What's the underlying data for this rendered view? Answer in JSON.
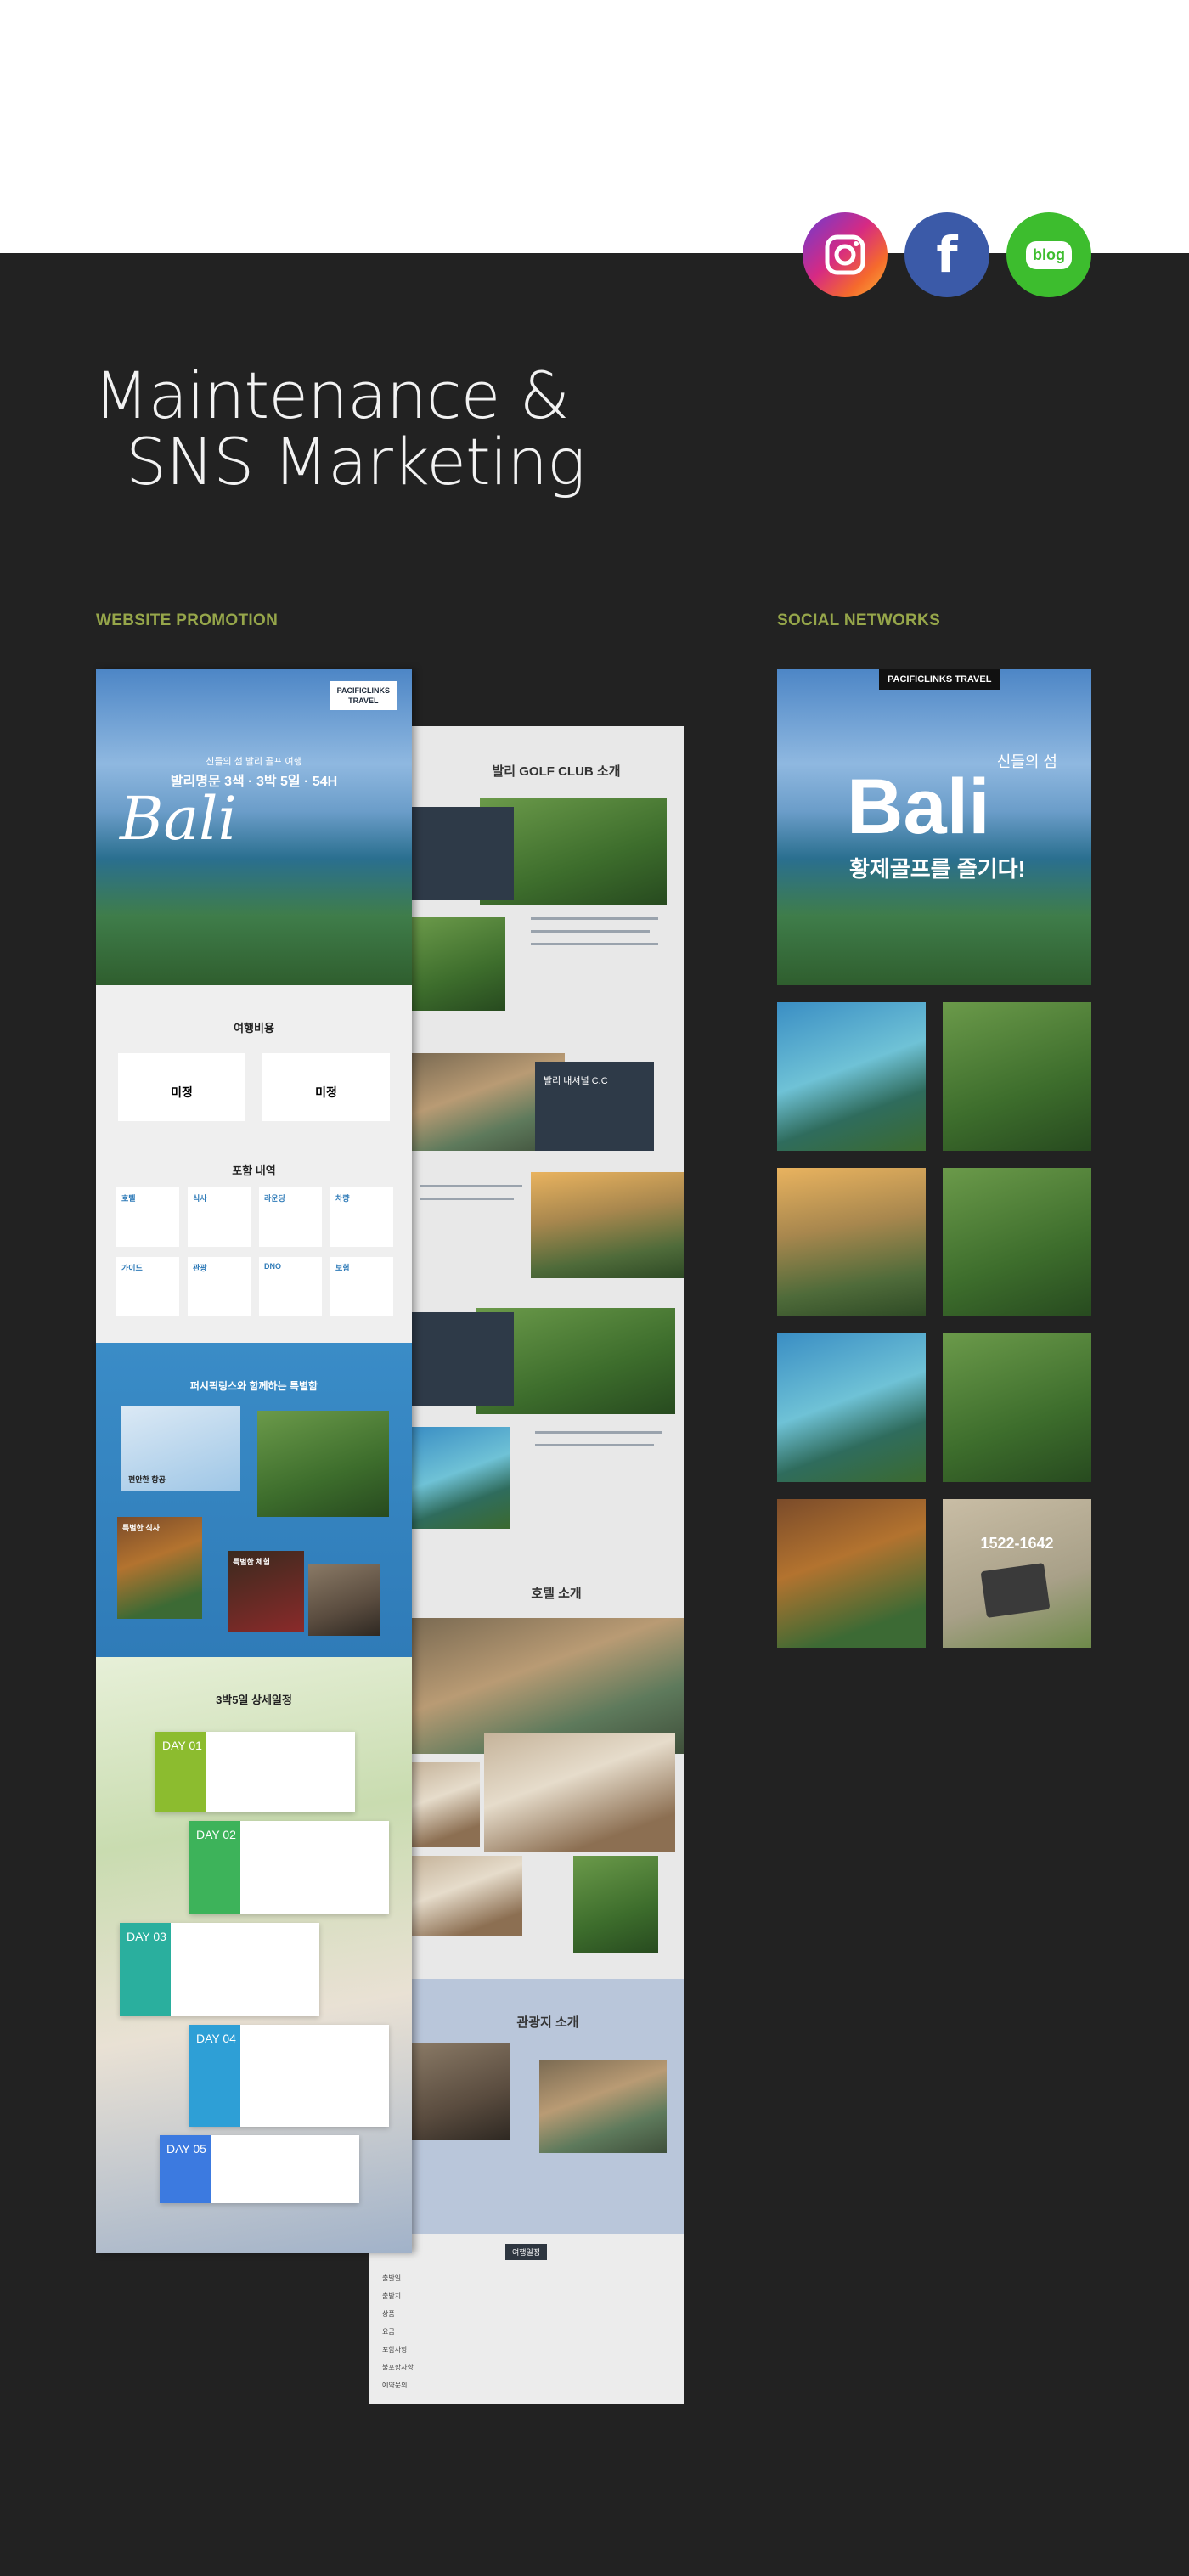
{
  "header": {
    "title_line1": "Maintenance &",
    "title_line2": "SNS Marketing",
    "sns": [
      "instagram-icon",
      "facebook-icon",
      "blog-icon"
    ],
    "blog_label": "blog",
    "facebook_glyph": "f"
  },
  "sections": {
    "website": "WEBSITE PROMOTION",
    "social": "SOCIAL NETWORKS"
  },
  "website_left": {
    "brand_line1": "PACIFICLINKS",
    "brand_line2": "TRAVEL",
    "hero_sub": "신들의 섬 발리 골프 여행",
    "hero_main": "발리명문 3색 · 3박 5일 · 54H",
    "hero_script": "Bali",
    "cost_title": "여행비용",
    "cost_col1": "미정",
    "cost_col2": "미정",
    "include_title": "포함 내역",
    "includes": [
      "호텔",
      "식사",
      "라운딩",
      "차량",
      "가이드",
      "관광",
      "DNO",
      "보험"
    ],
    "special_title": "퍼시픽링스와 함께하는 특별함",
    "special_items": [
      "편안한 항공",
      "특별한 식사",
      "특별한 체험"
    ],
    "schedule_title": "3박5일 상세일정",
    "days": [
      "DAY 01",
      "DAY 02",
      "DAY 03",
      "DAY 04",
      "DAY 05"
    ]
  },
  "website_right": {
    "golf_title": "발리 GOLF CLUB 소개",
    "club2": "발리 내셔널 C.C",
    "hotel_title": "호텔 소개",
    "tour_title": "관광지 소개",
    "info_button": "여행일정",
    "info_rows": [
      "출발일",
      "출발지",
      "상품",
      "요금",
      "포함사항",
      "불포함사항",
      "예약문의"
    ]
  },
  "social": {
    "top_tag": "PACIFICLINKS TRAVEL",
    "top_sub": "신들의 섬",
    "top_main": "Bali",
    "top_tagline": "황제골프를 즐기다!",
    "phone": "1522-1642"
  }
}
